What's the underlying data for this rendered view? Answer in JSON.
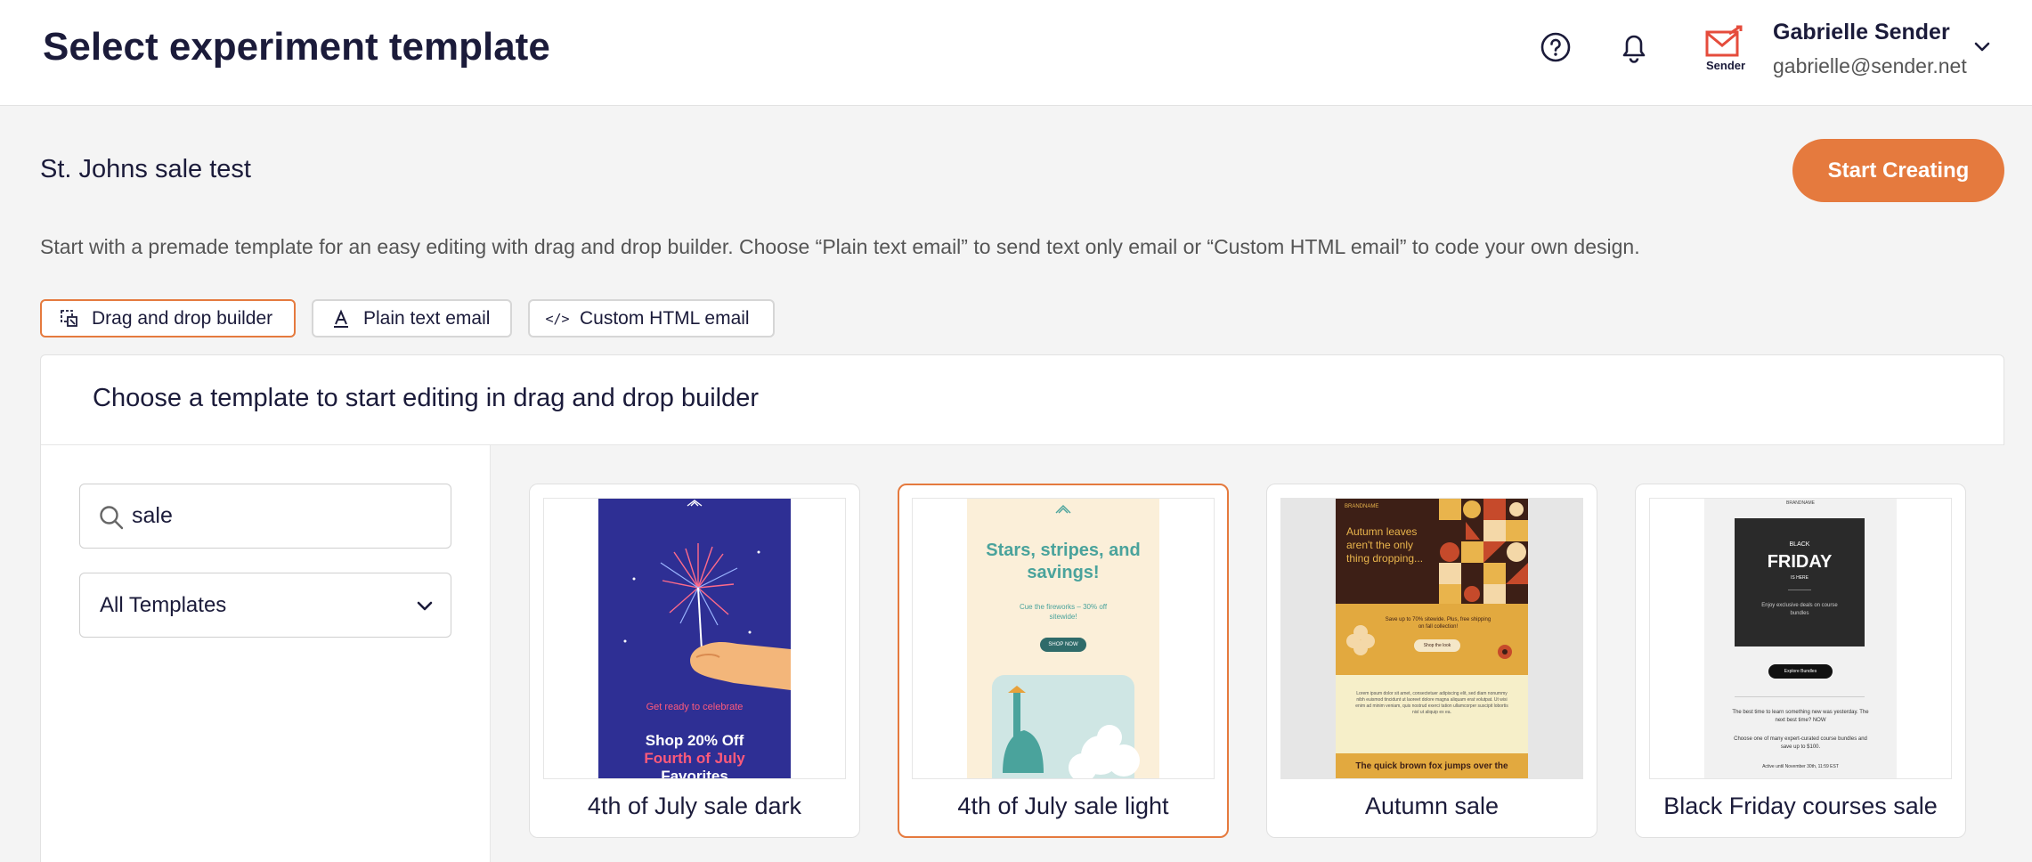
{
  "header": {
    "title": "Select experiment template",
    "help_icon": "help-circle-icon",
    "bell_icon": "bell-icon",
    "logo_text": "Sender",
    "user_name": "Gabrielle Sender",
    "user_email": "gabrielle@sender.net"
  },
  "experiment": {
    "name": "St. Johns sale test",
    "start_label": "Start Creating",
    "description": "Start with a premade template for an easy editing with drag and drop builder. Choose “Plain text email” to send text only email or “Custom HTML email” to code your own design."
  },
  "mode_tabs": [
    {
      "label": "Drag and drop builder",
      "icon": "drag-drop-icon",
      "active": true
    },
    {
      "label": "Plain text email",
      "icon": "text-format-icon",
      "active": false
    },
    {
      "label": "Custom HTML email",
      "icon": "code-icon",
      "active": false
    }
  ],
  "panel": {
    "title": "Choose a template to start editing in drag and drop builder",
    "search_value": "sale",
    "filter_selected": "All Templates"
  },
  "templates": [
    {
      "name": "4th of July sale dark",
      "preview": {
        "eyebrow": "Get ready to celebrate",
        "line1": "Shop 20% Off",
        "line2": "Fourth of July",
        "line3": "Favorites"
      }
    },
    {
      "name": "4th of July sale light",
      "preview": {
        "headline": "Stars, stripes, and savings!",
        "sub": "Cue the fireworks – 30% off sitewide!",
        "button": "SHOP NOW"
      }
    },
    {
      "name": "Autumn sale",
      "preview": {
        "brand": "BRANDNAME",
        "headline": "Autumn leaves aren't the only thing dropping...",
        "offer": "Save up to 70% sitewide. Plus, free shipping on fall collection!",
        "button": "Shop the look",
        "body": "Lorem ipsum dolor sit amet, consectetuer adipiscing elit, sed diam nonummy nibh euismod tincidunt ut laoreet dolore magna aliquam erat volutpat. Ut wisi enim ad minim veniam, quis nostrud exerci tation ullamcorper suscipit lobortis nisl ut aliquip ex ea.",
        "footer": "The quick brown fox jumps over the"
      }
    },
    {
      "name": "Black Friday courses sale",
      "preview": {
        "brand": "BRANDNAME",
        "black": "BLACK",
        "friday": "FRIDAY",
        "is_here": "IS HERE",
        "sub": "Enjoy exclusive deals on course bundles",
        "button": "Explore Bundles",
        "line1": "The best time to learn something new was yesterday. The next best time? NOW",
        "line2": "Choose one of many expert-curated course bundles and save up to $100.",
        "line3": "Active until November 30th, 11:59 EST"
      }
    }
  ],
  "colors": {
    "accent": "#e57a3e",
    "navy": "#1b1b3a",
    "dark_card_bg": "#2e2f94",
    "light_card_bg": "#fbefd9",
    "teal": "#4aa39c"
  }
}
